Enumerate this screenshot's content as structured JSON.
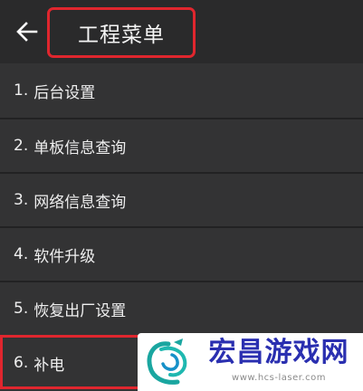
{
  "app_bar": {
    "back_icon": "arrow-left-icon",
    "title": "工程菜单"
  },
  "menu": {
    "items": [
      {
        "number": "1.",
        "label": "后台设置"
      },
      {
        "number": "2.",
        "label": "单板信息查询"
      },
      {
        "number": "3.",
        "label": "网络信息查询"
      },
      {
        "number": "4.",
        "label": "软件升级"
      },
      {
        "number": "5.",
        "label": "恢复出厂设置"
      },
      {
        "number": "6.",
        "label": "补电"
      }
    ]
  },
  "watermark": {
    "name": "宏昌游戏网",
    "url": "www.hcs-laser.com"
  },
  "colors": {
    "background": "#333334",
    "app_bar": "#2a2a2b",
    "highlight": "#e0262e",
    "watermark_text": "#2a2fb0"
  }
}
